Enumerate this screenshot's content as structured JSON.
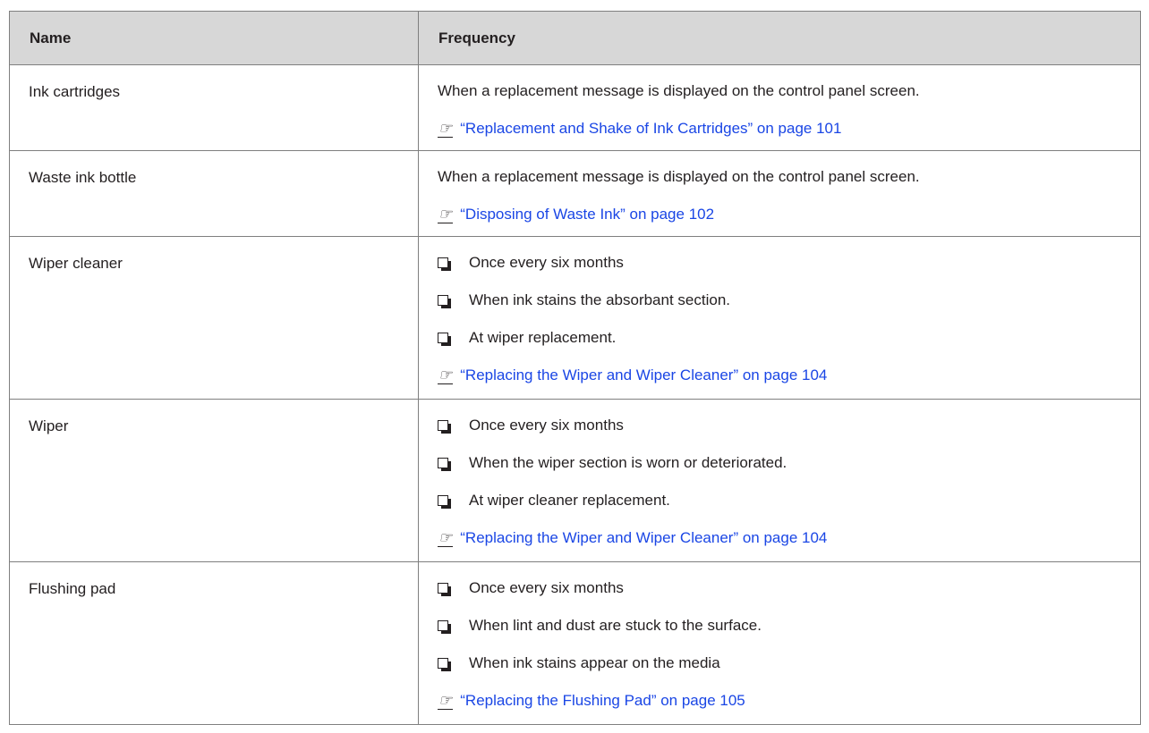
{
  "table": {
    "headers": {
      "name": "Name",
      "frequency": "Frequency"
    },
    "rows": [
      {
        "name": "Ink cartridges",
        "text": "When a replacement message is displayed on the control panel screen.",
        "link": "“Replacement and Shake of Ink Cartridges” on page 101"
      },
      {
        "name": "Waste ink bottle",
        "text": "When a replacement message is displayed on the control panel screen.",
        "link": "“Disposing of Waste Ink” on page 102"
      },
      {
        "name": "Wiper cleaner",
        "items": [
          "Once every six months",
          "When ink stains the absorbant section.",
          "At wiper replacement."
        ],
        "link": "“Replacing the Wiper and Wiper Cleaner” on page 104"
      },
      {
        "name": "Wiper",
        "items": [
          "Once every six months",
          "When the wiper section is worn or deteriorated.",
          "At wiper cleaner replacement."
        ],
        "link": "“Replacing the Wiper and Wiper Cleaner” on page 104"
      },
      {
        "name": "Flushing pad",
        "items": [
          "Once every six months",
          "When lint and dust are stuck to the surface.",
          "When ink stains appear on the media"
        ],
        "link": "“Replacing the Flushing Pad” on page 105"
      }
    ]
  },
  "icons": {
    "checkbox": "checkbox-icon",
    "reference": "reference-arrow-icon"
  },
  "colors": {
    "header_bg": "#d7d7d7",
    "link": "#1a46e5",
    "border": "#7f7f7f",
    "text": "#231f20"
  }
}
